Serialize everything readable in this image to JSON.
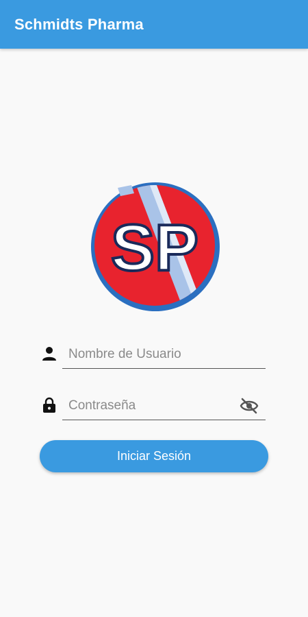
{
  "appbar": {
    "title": "Schmidts Pharma"
  },
  "logo": {
    "text": "SP",
    "colors": {
      "ring": "#2b6fc0",
      "disc": "#e8232e",
      "stripe": "#a9c3e8",
      "letters": "#ffffff",
      "letter_outline": "#1a2a5a"
    }
  },
  "form": {
    "username": {
      "placeholder": "Nombre de Usuario",
      "value": "",
      "icon": "person-icon"
    },
    "password": {
      "placeholder": "Contraseña",
      "value": "",
      "icon": "lock-icon",
      "toggle_icon": "visibility-off-icon"
    },
    "submit_label": "Iniciar Sesión"
  },
  "colors": {
    "accent": "#3a9ae0",
    "background": "#f9f9f9"
  }
}
